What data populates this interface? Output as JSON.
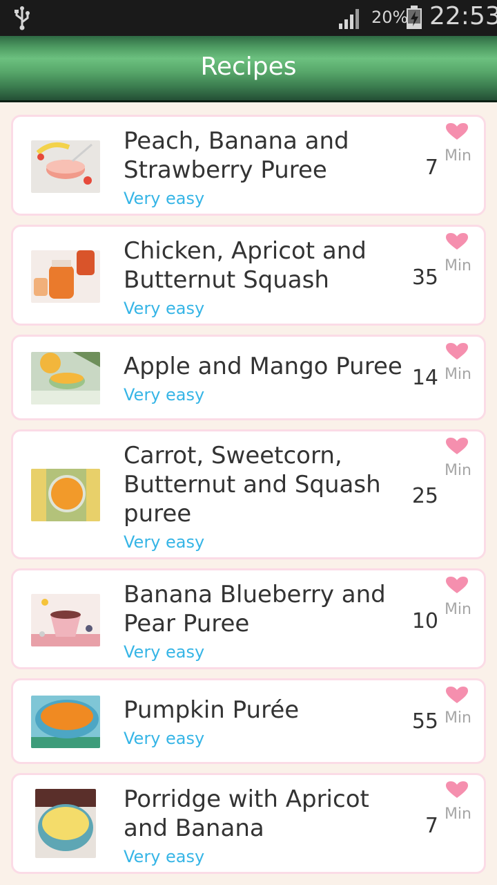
{
  "status_bar": {
    "battery_percent": "20%",
    "time": "22:53",
    "icons": [
      "usb-icon",
      "signal-icon",
      "battery-charging-icon"
    ]
  },
  "app_bar": {
    "title": "Recipes"
  },
  "recipes": [
    {
      "title": "Peach, Banana and Strawberry Puree",
      "difficulty": "Very easy",
      "minutes": "7",
      "min_label": "Min",
      "thumb_colors": [
        "#e9e6e2",
        "#f19a8a",
        "#e64a3b"
      ]
    },
    {
      "title": "Chicken, Apricot and Butternut Squash",
      "difficulty": "Very easy",
      "minutes": "35",
      "min_label": "Min",
      "thumb_colors": [
        "#f4ece8",
        "#ea7a2c",
        "#d9542a"
      ]
    },
    {
      "title": "Apple and Mango Puree",
      "difficulty": "Very easy",
      "minutes": "14",
      "min_label": "Min",
      "thumb_colors": [
        "#c9d8c4",
        "#f2b63c",
        "#6e8f5a"
      ]
    },
    {
      "title": "Carrot, Sweetcorn, Butternut and Squash puree",
      "difficulty": "Very easy",
      "minutes": "25",
      "min_label": "Min",
      "thumb_colors": [
        "#e8d06a",
        "#f29a2a",
        "#b3c27a"
      ]
    },
    {
      "title": "Banana Blueberry and Pear Puree",
      "difficulty": "Very easy",
      "minutes": "10",
      "min_label": "Min",
      "thumb_colors": [
        "#f6ece9",
        "#7c3b3a",
        "#e8a0a8"
      ]
    },
    {
      "title": "Pumpkin Purée",
      "difficulty": "Very easy",
      "minutes": "55",
      "min_label": "Min",
      "thumb_colors": [
        "#7fc6d6",
        "#f08a22",
        "#4da6c4"
      ]
    },
    {
      "title": "Porridge with Apricot and Banana",
      "difficulty": "Very easy",
      "minutes": "7",
      "min_label": "Min",
      "thumb_colors": [
        "#5a2f2a",
        "#f4dc6a",
        "#5ea6b4"
      ]
    }
  ],
  "colors": {
    "difficulty": "#36b5e6",
    "heart": "#f58fae",
    "card_border": "#fbdbe6",
    "background": "#faf1e9"
  }
}
